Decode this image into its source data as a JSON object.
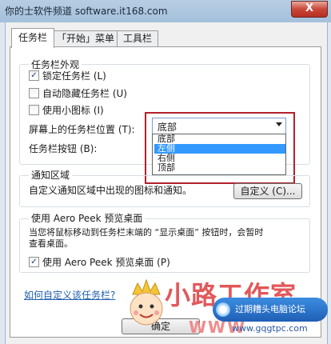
{
  "window": {
    "title": "你的士软件频道 software.it168.com",
    "close_label": "X"
  },
  "tabs": [
    {
      "label": "任务栏"
    },
    {
      "label": "「开始」菜单"
    },
    {
      "label": "工具栏"
    }
  ],
  "appearance": {
    "group_title": "任务栏外观",
    "lock_taskbar": {
      "label": "锁定任务栏 (L)",
      "checked": true
    },
    "auto_hide": {
      "label": "自动隐藏任务栏 (U)",
      "checked": false
    },
    "small_icons": {
      "label": "使用小图标 (I)",
      "checked": false
    },
    "location_label": "屏幕上的任务栏位置 (T):",
    "location_value": "底部",
    "location_options": [
      "底部",
      "左侧",
      "右侧",
      "顶部"
    ],
    "highlighted_option": "左侧",
    "buttons_label": "任务栏按钮 (B):"
  },
  "notification": {
    "group_title": "通知区域",
    "description": "自定义通知区域中出现的图标和通知。",
    "customize_button": "自定义 (C)..."
  },
  "aero_peek": {
    "group_title": "使用 Aero Peek 预览桌面",
    "description_line1": "当您将鼠标移动到任务栏末端的 “显示桌面” 按钮时，会暂时",
    "description_line2": "查看桌面。",
    "use_peek": {
      "label": "使用 Aero Peek 预览桌面 (P)",
      "checked": true
    }
  },
  "help_link": "如何自定义该任务栏?",
  "ok_button": "确定",
  "watermark": {
    "brand_text": "小路工作室",
    "badge_text": "过期糟头电脑论坛",
    "url": "www.gqgtpc.com",
    "www": "WWW"
  },
  "colors": {
    "highlight": "#3399ff",
    "annotation_box": "#b2222d",
    "link": "#1f5fae"
  }
}
